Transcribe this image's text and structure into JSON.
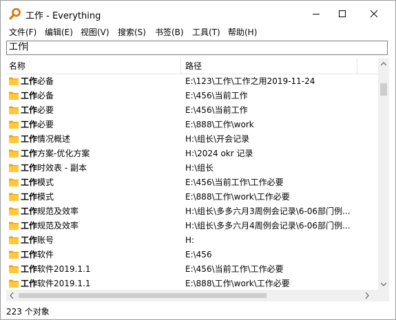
{
  "window": {
    "title": "工作 - Everything"
  },
  "menu": [
    "文件(F)",
    "编辑(E)",
    "视图(V)",
    "搜索(S)",
    "书签(B)",
    "工具(T)",
    "帮助(H)"
  ],
  "search": {
    "value": "工作"
  },
  "columns": {
    "name": "名称",
    "path": "路径"
  },
  "rows": [
    {
      "bold": "工作",
      "rest": "必备",
      "path": "E:\\123\\工作\\工作之用2019-11-24"
    },
    {
      "bold": "工作",
      "rest": "必备",
      "path": "E:\\456\\当前工作"
    },
    {
      "bold": "工作",
      "rest": "必要",
      "path": "E:\\456\\当前工作"
    },
    {
      "bold": "工作",
      "rest": "必要",
      "path": "E:\\888\\工作\\work"
    },
    {
      "bold": "工作",
      "rest": "情况概述",
      "path": "H:\\组长\\开会记录"
    },
    {
      "bold": "工作",
      "rest": "方案-优化方案",
      "path": "H:\\2024 okr 记录"
    },
    {
      "bold": "工作",
      "rest": "时效表 - 副本",
      "path": "H:\\组长"
    },
    {
      "bold": "工作",
      "rest": "模式",
      "path": "E:\\456\\当前工作\\工作必要"
    },
    {
      "bold": "工作",
      "rest": "模式",
      "path": "E:\\888\\工作\\work\\工作必要"
    },
    {
      "bold": "工作",
      "rest": "规范及效率",
      "path": "H:\\组长\\多多六月3周例会记录\\6-06部门例..."
    },
    {
      "bold": "工作",
      "rest": "规范及效率",
      "path": "H:\\组长\\多多六月4周例会记录\\6-06部门例..."
    },
    {
      "bold": "工作",
      "rest": "账号",
      "path": "H:"
    },
    {
      "bold": "工作",
      "rest": "软件",
      "path": "E:\\456"
    },
    {
      "bold": "工作",
      "rest": "软件2019.1.1",
      "path": "E:\\456\\当前工作\\工作必要"
    },
    {
      "bold": "工作",
      "rest": "软件2019.1.1",
      "path": "E:\\888\\工作\\work\\工作必要"
    }
  ],
  "status": "223 个对象",
  "colors": {
    "folder": "#ffc83d",
    "folder_tab": "#e8a317"
  }
}
